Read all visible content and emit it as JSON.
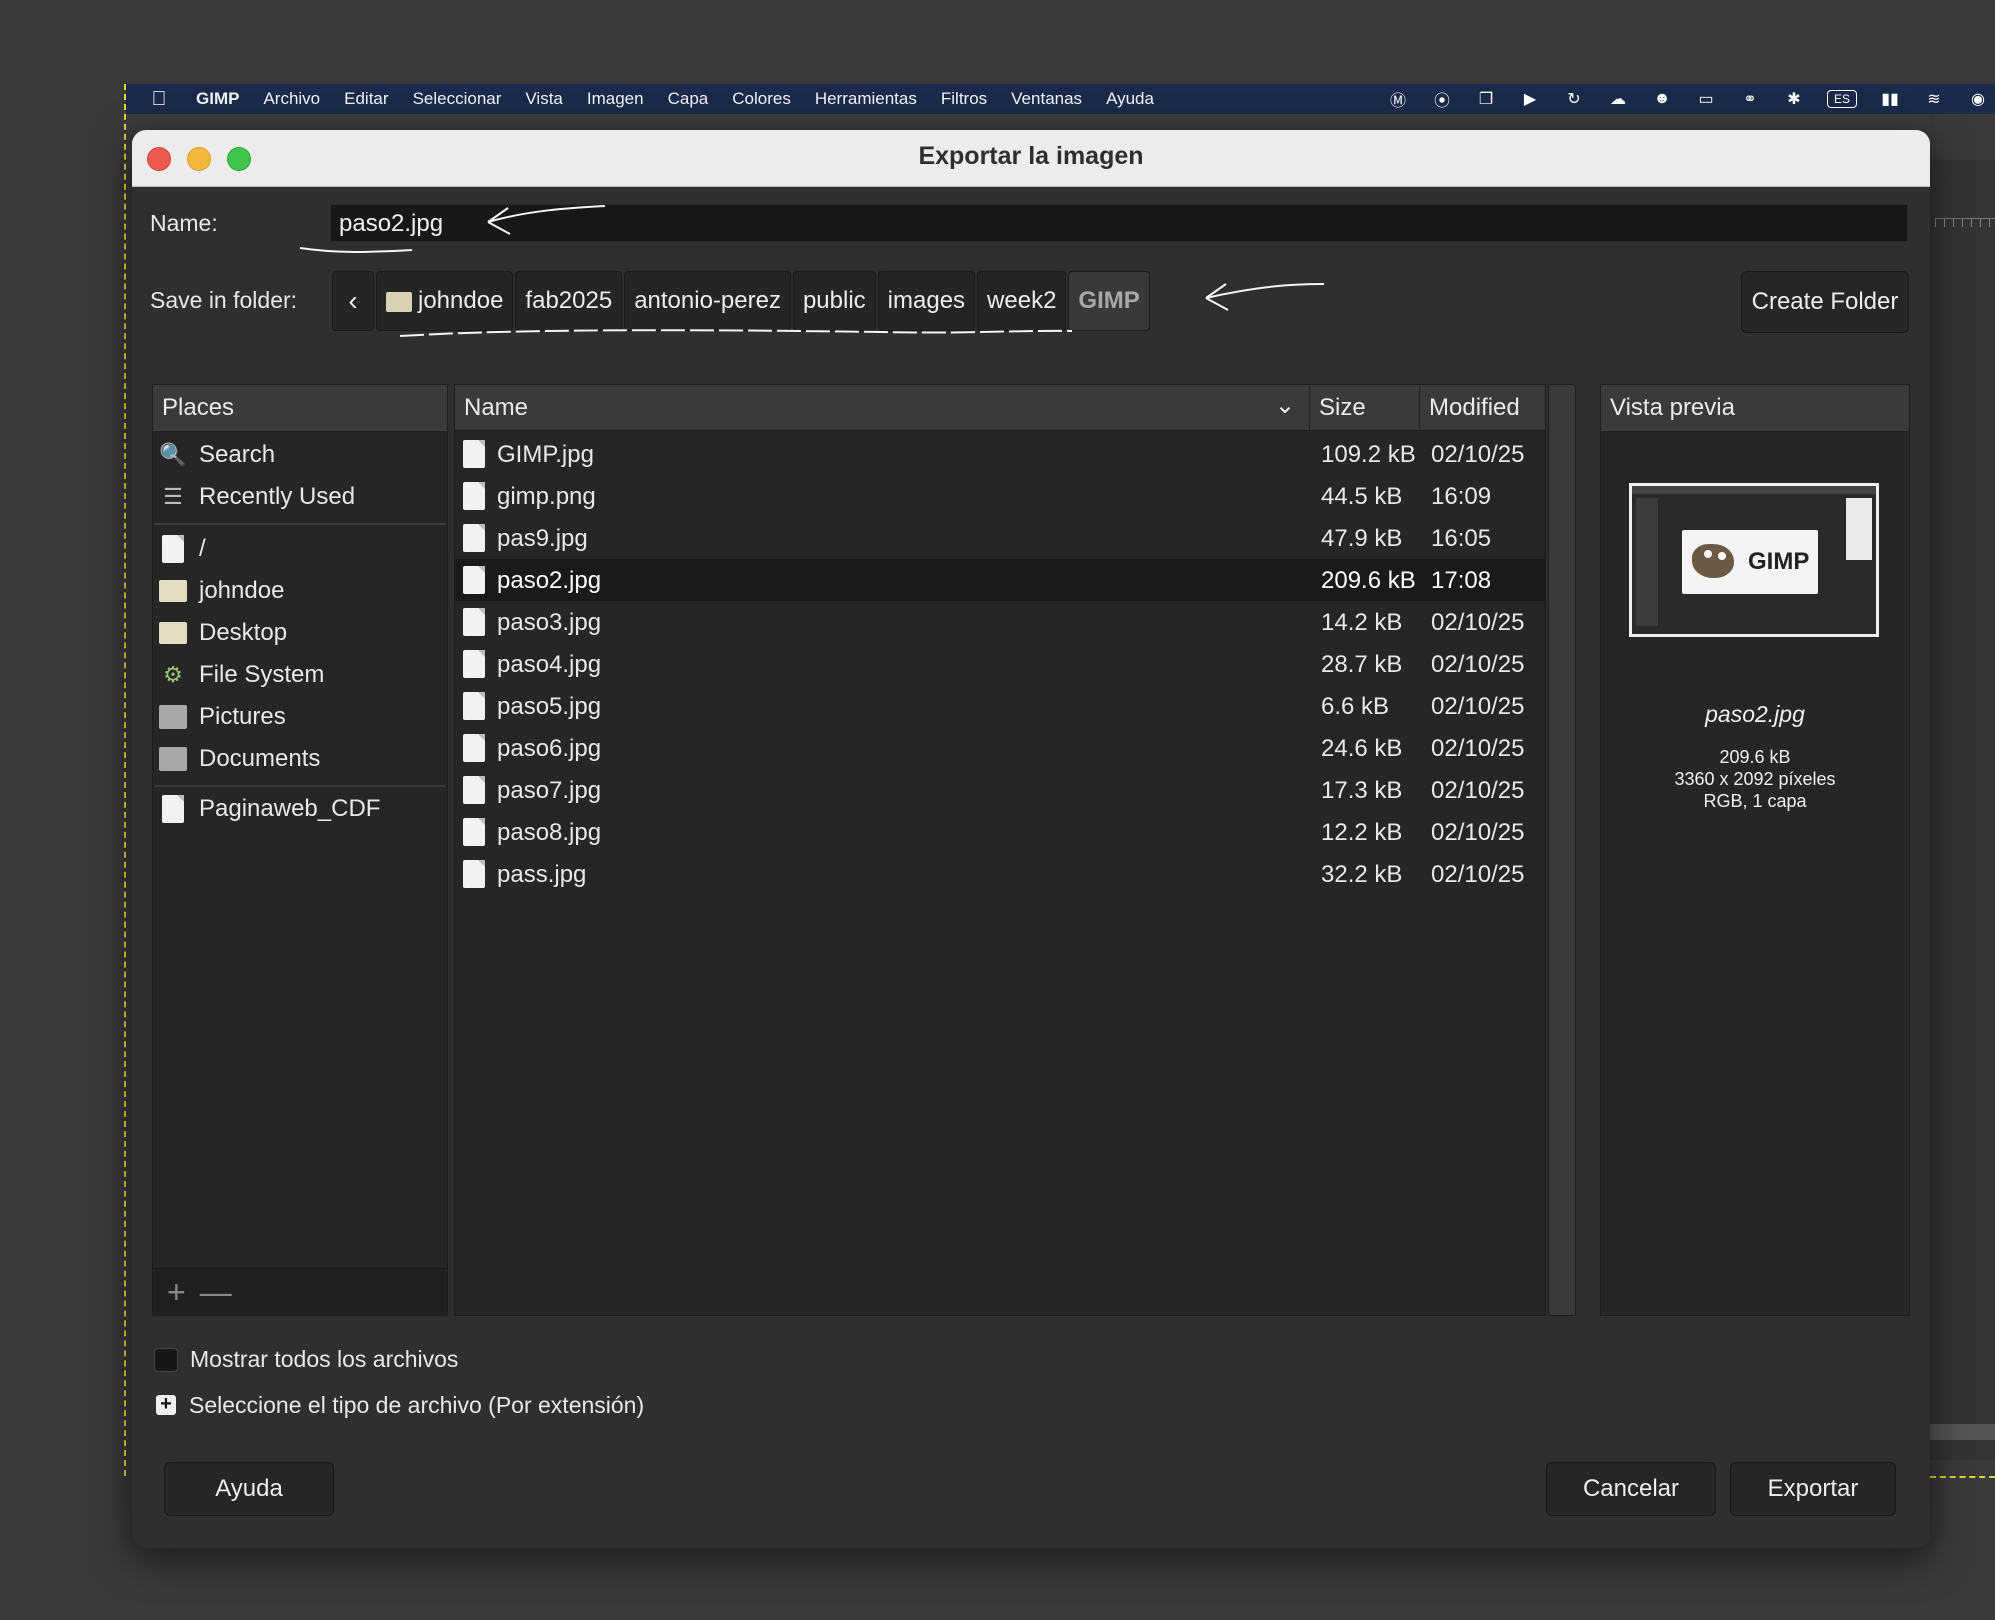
{
  "menubar": {
    "app": "GIMP",
    "items": [
      "Archivo",
      "Editar",
      "Seleccionar",
      "Vista",
      "Imagen",
      "Capa",
      "Colores",
      "Herramientas",
      "Filtros",
      "Ventanas",
      "Ayuda"
    ],
    "lang": "ES"
  },
  "dialog": {
    "title": "Exportar la imagen",
    "name_label": "Name:",
    "name_value": "paso2.jpg",
    "folder_label": "Save in folder:",
    "breadcrumbs": [
      "johndoe",
      "fab2025",
      "antonio-perez",
      "public",
      "images",
      "week2",
      "GIMP"
    ],
    "create_folder": "Create Folder"
  },
  "places": {
    "header": "Places",
    "items": [
      "Search",
      "Recently Used",
      "/",
      "johndoe",
      "Desktop",
      "File System",
      "Pictures",
      "Documents",
      "Paginaweb_CDF"
    ]
  },
  "files": {
    "columns": {
      "name": "Name",
      "size": "Size",
      "modified": "Modified"
    },
    "rows": [
      {
        "name": "GIMP.jpg",
        "size": "109.2 kB",
        "modified": "02/10/25"
      },
      {
        "name": "gimp.png",
        "size": "44.5 kB",
        "modified": "16:09"
      },
      {
        "name": "pas9.jpg",
        "size": "47.9 kB",
        "modified": "16:05"
      },
      {
        "name": "paso2.jpg",
        "size": "209.6 kB",
        "modified": "17:08"
      },
      {
        "name": "paso3.jpg",
        "size": "14.2 kB",
        "modified": "02/10/25"
      },
      {
        "name": "paso4.jpg",
        "size": "28.7 kB",
        "modified": "02/10/25"
      },
      {
        "name": "paso5.jpg",
        "size": "6.6 kB",
        "modified": "02/10/25"
      },
      {
        "name": "paso6.jpg",
        "size": "24.6 kB",
        "modified": "02/10/25"
      },
      {
        "name": "paso7.jpg",
        "size": "17.3 kB",
        "modified": "02/10/25"
      },
      {
        "name": "paso8.jpg",
        "size": "12.2 kB",
        "modified": "02/10/25"
      },
      {
        "name": "pass.jpg",
        "size": "32.2 kB",
        "modified": "02/10/25"
      }
    ],
    "selected_index": 3
  },
  "preview": {
    "header": "Vista previa",
    "thumb_label": "GIMP",
    "filename": "paso2.jpg",
    "size": "209.6 kB",
    "dimensions": "3360 x 2092 píxeles",
    "info": "RGB, 1 capa"
  },
  "options": {
    "show_all": "Mostrar todos los archivos",
    "file_type": "Seleccione el tipo de archivo (Por extensión)"
  },
  "buttons": {
    "help": "Ayuda",
    "cancel": "Cancelar",
    "export": "Exportar"
  }
}
